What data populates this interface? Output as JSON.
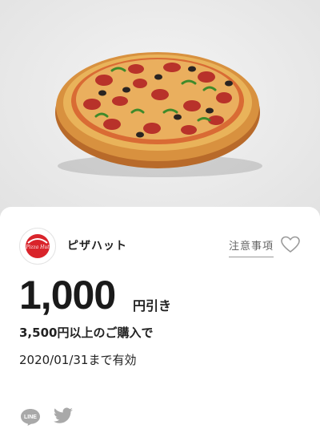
{
  "hero": {
    "icon": "pizza-image"
  },
  "coupon": {
    "brand_name": "ピザハット",
    "logo_text": "Pizza Hut",
    "notes_label": "注意事項",
    "amount": "1,000",
    "amount_suffix": "円引き",
    "condition": "3,500円以上のご購入で",
    "validity": "2020/01/31まで有効"
  },
  "share": {
    "line_label": "LINE",
    "icons": [
      "line-icon",
      "twitter-icon"
    ]
  },
  "colors": {
    "brand_red": "#d9242b",
    "share_icon_gray": "#a9a9a9",
    "card_background": "#ffffff",
    "page_background": "#ebebeb"
  }
}
